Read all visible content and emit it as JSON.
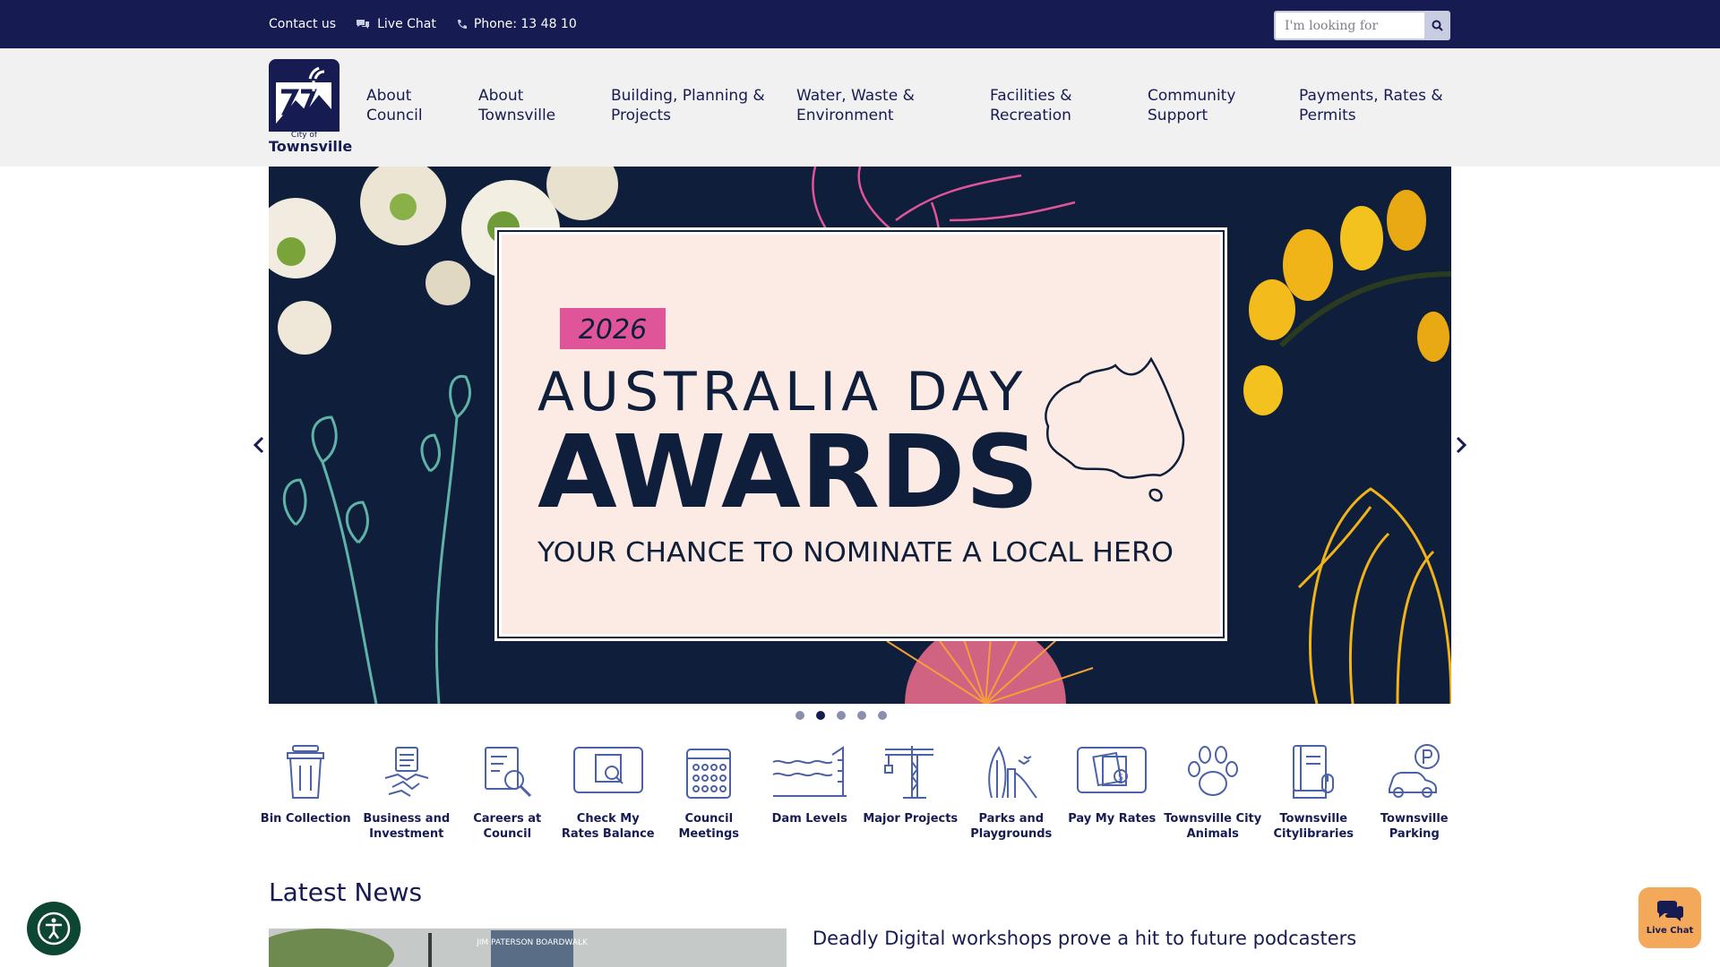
{
  "topbar": {
    "contact": "Contact us",
    "live_chat": "Live Chat",
    "phone": "Phone: 13 48 10",
    "search_placeholder": "I'm looking for",
    "icons": [
      "chat-bubbles-icon",
      "phone-icon",
      "search-icon"
    ]
  },
  "logo": {
    "small": "City of",
    "name": "Townsville"
  },
  "nav": [
    {
      "label": "About\nCouncil"
    },
    {
      "label": "About\nTownsville"
    },
    {
      "label": "Building, Planning &\nProjects"
    },
    {
      "label": "Water, Waste &\nEnvironment"
    },
    {
      "label": "Facilities &\nRecreation"
    },
    {
      "label": "Community\nSupport"
    },
    {
      "label": "Payments, Rates &\nPermits"
    }
  ],
  "banner": {
    "year": "2026",
    "line1": "AUSTRALIA DAY",
    "line2": "AWARDS",
    "line3": "YOUR CHANCE TO NOMINATE A LOCAL HERO",
    "slides_total": 5,
    "active_slide": 2
  },
  "quick_links": [
    {
      "label": "Bin Collection",
      "icon": "bin-icon"
    },
    {
      "label": "Business and\nInvestment",
      "icon": "handshake-icon"
    },
    {
      "label": "Careers at\nCouncil",
      "icon": "careers-search-icon"
    },
    {
      "label": "Check My\nRates Balance",
      "icon": "monitor-rates-icon"
    },
    {
      "label": "Council\nMeetings",
      "icon": "calendar-icon"
    },
    {
      "label": "Dam Levels",
      "icon": "dam-level-icon"
    },
    {
      "label": "Major Projects",
      "icon": "crane-icon"
    },
    {
      "label": "Parks and\nPlaygrounds",
      "icon": "playground-icon"
    },
    {
      "label": "Pay My Rates",
      "icon": "pay-rates-icon"
    },
    {
      "label": "Townsville City\nAnimals",
      "icon": "paw-icon"
    },
    {
      "label": "Townsville\nCitylibraries",
      "icon": "library-icon"
    },
    {
      "label": "Townsville\nParking",
      "icon": "parking-icon"
    }
  ],
  "news": {
    "heading": "Latest News",
    "title": "Deadly Digital workshops prove a hit to future podcasters",
    "sign_text": "JIM PATERSON BOARDWALK"
  },
  "live_chat_button": "Live Chat",
  "colors": {
    "navy": "#161b52",
    "banner_bg": "#0f1e3a",
    "pink": "#e0559a",
    "cream": "#fcebe4",
    "chat_orange": "#f3a85a",
    "access_green": "#0d4632"
  }
}
